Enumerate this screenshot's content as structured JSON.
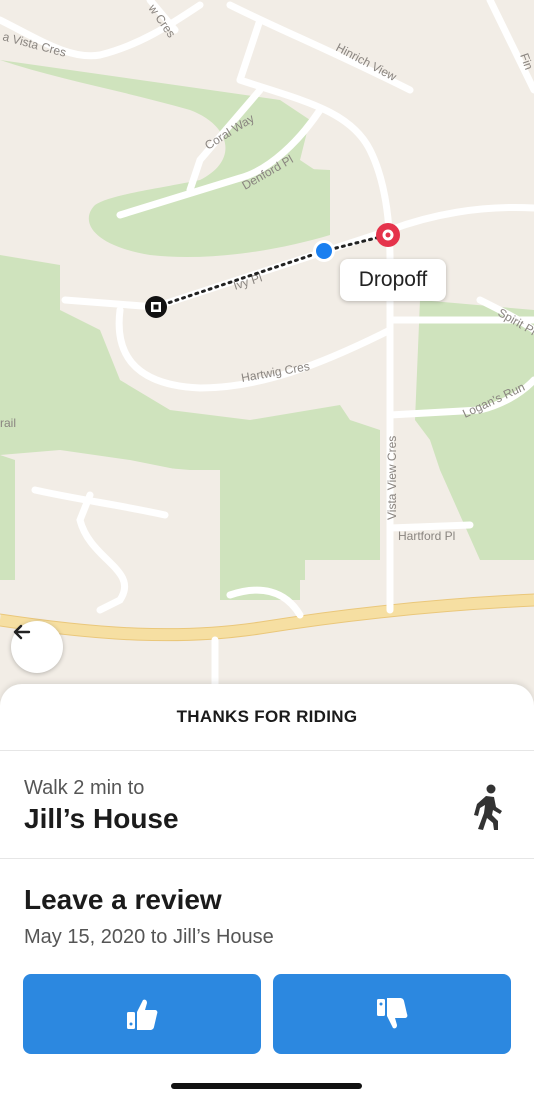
{
  "map": {
    "dropoff_label": "Dropoff",
    "road_labels": {
      "vista_cres_top": "a Vista Cres",
      "view_cres": "w Cres",
      "hinrich": "Hinrich View",
      "fin": "Fin",
      "coral": "Coral Way",
      "denford": "Denford Pl",
      "ivy": "Ivy Pl",
      "hartwig": "Hartwig Cres",
      "spirit": "Spirit Pl",
      "logans": "Logan's Run",
      "vista_view": "Vista View Cres",
      "hartford": "Hartford Pl",
      "trail": "rail"
    }
  },
  "sheet": {
    "title": "THANKS FOR RIDING",
    "walk": {
      "line1": "Walk 2 min to",
      "destination": "Jill’s House"
    },
    "review": {
      "title": "Leave a review",
      "subtitle": "May 15, 2020 to Jill’s House"
    }
  },
  "icons": {
    "back": "arrow-left-icon",
    "walk": "walking-person-icon",
    "thumbs_up": "thumbs-up-icon",
    "thumbs_down": "thumbs-down-icon"
  },
  "colors": {
    "accent": "#2c88e0",
    "dropoff_pin": "#e5334b",
    "current_location": "#1a7ff0",
    "park": "#cfe3bd"
  }
}
